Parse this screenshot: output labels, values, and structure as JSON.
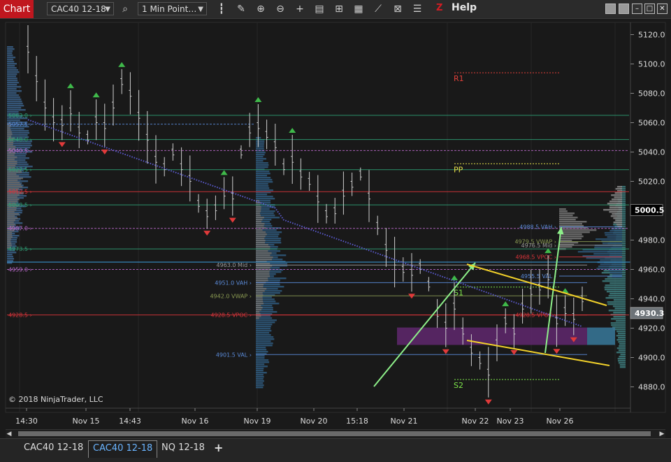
{
  "toolbar": {
    "chart_label": "Chart",
    "instrument": "CAC40 12-18",
    "interval": "1 Min Point…",
    "help_label": "Help",
    "icons": [
      "search-icon",
      "bar-type-icon",
      "pencil-icon",
      "zoom-in-icon",
      "zoom-out-icon",
      "crosshair-icon",
      "data-box-icon",
      "templates-icon",
      "strategies-icon",
      "indicators-icon",
      "properties-icon",
      "list-icon"
    ]
  },
  "copyright": "© 2018 NinjaTrader, LLC",
  "tabs": [
    {
      "label": "CAC40 12-18",
      "active": false
    },
    {
      "label": "CAC40 12-18",
      "active": true
    },
    {
      "label": "NQ 12-18",
      "active": false
    },
    {
      "label": "+",
      "active": false
    }
  ],
  "chart_data": {
    "type": "line",
    "instrument": "CAC40 12-18",
    "y_ticks": [
      5120,
      5100,
      5080,
      5060,
      5040,
      5020,
      4980,
      4960,
      4940,
      4920,
      4900,
      4880
    ],
    "ylim": [
      4870,
      5130
    ],
    "x_labels": [
      "14:30",
      "Nov 15",
      "14:43",
      "Nov 16",
      "Nov 19",
      "Nov 20",
      "15:18",
      "Nov 21",
      "Nov 22",
      "Nov 23",
      "Nov 26"
    ],
    "last_price": "5000.5",
    "crosshair_price": "4930.3",
    "pivots": [
      {
        "label": "R1",
        "value": 5094,
        "color": "#e2403a"
      },
      {
        "label": "PP",
        "value": 5032,
        "color": "#e6e04a"
      },
      {
        "label": "S1",
        "value": 4948,
        "color": "#7ee84a"
      },
      {
        "label": "S2",
        "value": 4885,
        "color": "#7ee84a"
      }
    ],
    "profile_levels_left": [
      {
        "label": "5063.0",
        "value": 5065,
        "color": "#2e9e74"
      },
      {
        "label": "5057.5",
        "value": 5059,
        "color": "#5a8ad8"
      },
      {
        "label": "5048.0",
        "value": 5048.5,
        "color": "#2e9e74"
      },
      {
        "label": "5040.5",
        "value": 5041,
        "color": "#b868c8"
      },
      {
        "label": "5027.5",
        "value": 5028,
        "color": "#2e9e74"
      },
      {
        "label": "5012.5",
        "value": 5013,
        "color": "#d8343a"
      },
      {
        "label": "5003.5",
        "value": 5004,
        "color": "#2e9e74"
      },
      {
        "label": "4987.0",
        "value": 4988,
        "color": "#b868c8"
      },
      {
        "label": "4973.5",
        "value": 4974,
        "color": "#2e9e74"
      },
      {
        "label": "4959.0",
        "value": 4960,
        "color": "#b868c8"
      },
      {
        "label": "4928.5",
        "value": 4929,
        "color": "#d8343a"
      }
    ],
    "profile_levels_mid": [
      {
        "label": "4963.0 Mid",
        "value": 4963,
        "color": "#999999"
      },
      {
        "label": "4951.0 VAH",
        "value": 4951,
        "color": "#5a8ad8"
      },
      {
        "label": "4942.0 VWAP",
        "value": 4942,
        "color": "#8a9a52"
      },
      {
        "label": "4928.5 VPOC",
        "value": 4929,
        "color": "#d8343a"
      },
      {
        "label": "4901.5 VAL",
        "value": 4902,
        "color": "#5a8ad8"
      }
    ],
    "profile_levels_right": [
      {
        "label": "4988.5 VAH",
        "value": 4989,
        "color": "#5a8ad8"
      },
      {
        "label": "4979.5 VWAP",
        "value": 4979,
        "color": "#8a9a52"
      },
      {
        "label": "4976.5 Mid",
        "value": 4976.5,
        "color": "#999999"
      },
      {
        "label": "4968.5 VPOC",
        "value": 4968.5,
        "color": "#d8343a"
      },
      {
        "label": "4955.5 VAL",
        "value": 4955.5,
        "color": "#5a8ad8"
      },
      {
        "label": "4928.5 VPOC",
        "value": 4929,
        "color": "#d8343a"
      }
    ],
    "series": [
      {
        "name": "",
        "x": [
          0,
          2,
          4,
          6,
          8,
          10,
          12,
          14,
          16,
          18,
          20,
          22,
          24,
          26,
          28,
          30,
          32,
          34,
          36,
          38,
          40,
          42,
          44,
          46,
          48,
          50,
          52,
          54,
          56,
          58,
          60,
          62,
          64,
          66,
          68,
          70,
          72,
          74,
          76,
          78,
          80,
          82,
          84,
          86,
          88,
          90,
          92,
          94,
          96,
          98,
          100,
          102,
          104,
          106,
          108,
          110,
          112,
          114,
          116,
          118,
          120,
          122,
          124,
          126,
          128,
          130
        ],
        "values": [
          5110,
          5090,
          5072,
          5062,
          5060,
          5068,
          5055,
          5050,
          5062,
          5058,
          5072,
          5088,
          5080,
          5065,
          5050,
          5035,
          5030,
          5040,
          5030,
          5022,
          5005,
          4998,
          5002,
          5012,
          5010,
          5040,
          5055,
          5058,
          5052,
          5045,
          5030,
          5035,
          5025,
          5020,
          5008,
          4998,
          5000,
          5012,
          5018,
          5025,
          5010,
          4990,
          4975,
          4965,
          4960,
          4958,
          4962,
          4950,
          4930,
          4922,
          4935,
          4918,
          4905,
          4898,
          4890,
          4910,
          4925,
          4918,
          4935,
          4945,
          4948,
          4955,
          4925,
          4932,
          4928,
          4940
        ]
      }
    ],
    "value_area_box": {
      "low": 4910,
      "high": 4919
    }
  }
}
